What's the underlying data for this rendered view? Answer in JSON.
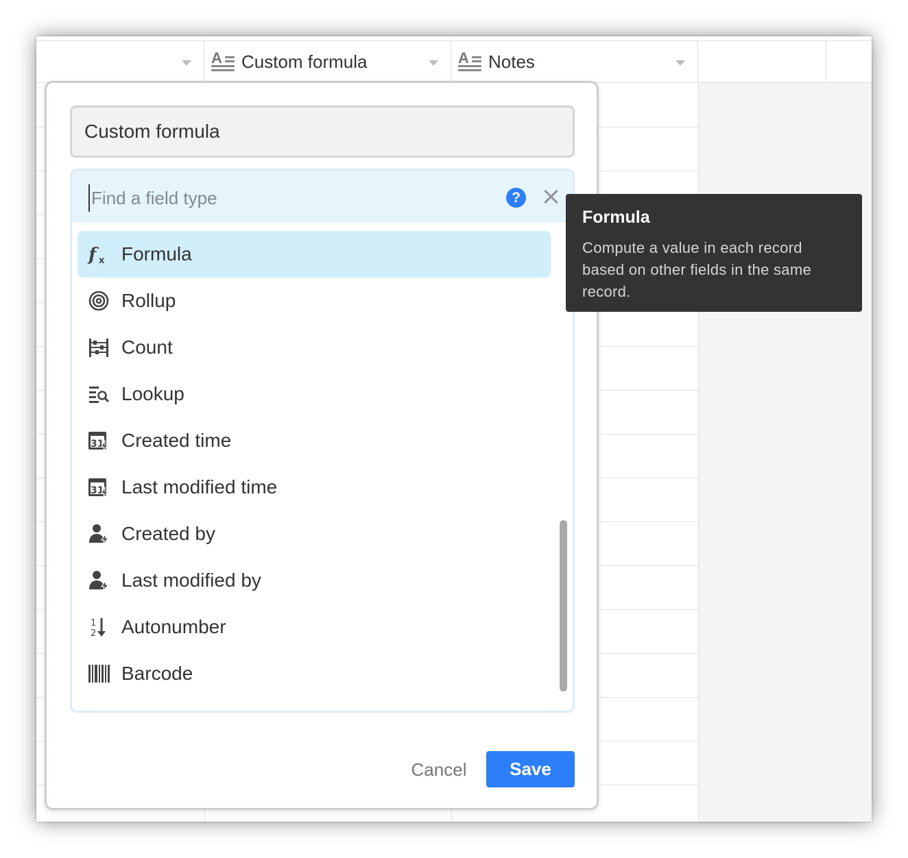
{
  "grid": {
    "columns": [
      {
        "label": ""
      },
      {
        "label": "Custom formula",
        "icon": "long-text-icon"
      },
      {
        "label": "Notes",
        "icon": "long-text-icon"
      }
    ],
    "add_column_icon": "plus-icon"
  },
  "dialog": {
    "field_name_value": "Custom formula",
    "search": {
      "placeholder": "Find a field type",
      "help_icon": "question-icon",
      "help_glyph": "?",
      "clear_icon": "close-icon"
    },
    "field_types": [
      {
        "label": "Formula",
        "icon": "formula-icon",
        "selected": true
      },
      {
        "label": "Rollup",
        "icon": "rollup-spiral-icon"
      },
      {
        "label": "Count",
        "icon": "count-abacus-icon"
      },
      {
        "label": "Lookup",
        "icon": "lookup-icon"
      },
      {
        "label": "Created time",
        "icon": "calendar-bolt-icon"
      },
      {
        "label": "Last modified time",
        "icon": "calendar-bolt-icon"
      },
      {
        "label": "Created by",
        "icon": "user-bolt-icon"
      },
      {
        "label": "Last modified by",
        "icon": "user-bolt-icon"
      },
      {
        "label": "Autonumber",
        "icon": "autonumber-icon"
      },
      {
        "label": "Barcode",
        "icon": "barcode-icon"
      }
    ],
    "cancel_label": "Cancel",
    "save_label": "Save"
  },
  "tooltip": {
    "title": "Formula",
    "description": "Compute a value in each record based on other fields in the same record."
  },
  "colors": {
    "accent": "#2d7ff9",
    "selected_bg": "#d1eefb",
    "search_bg": "#e6f4fb",
    "tooltip_bg": "#333333"
  }
}
